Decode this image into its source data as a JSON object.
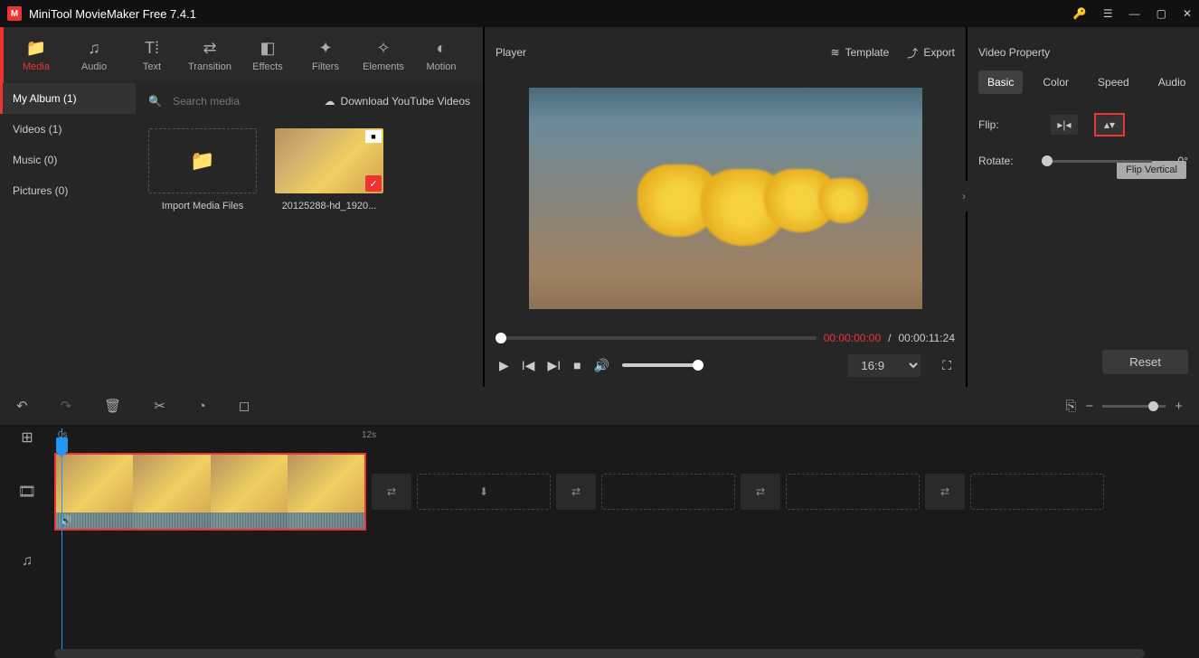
{
  "app": {
    "title": "MiniTool MovieMaker Free 7.4.1"
  },
  "toolbar": {
    "media": "Media",
    "audio": "Audio",
    "text": "Text",
    "transition": "Transition",
    "effects": "Effects",
    "filters": "Filters",
    "elements": "Elements",
    "motion": "Motion"
  },
  "album": {
    "my_album": "My Album (1)",
    "videos": "Videos (1)",
    "music": "Music (0)",
    "pictures": "Pictures (0)"
  },
  "media": {
    "search_placeholder": "Search media",
    "download_label": "Download YouTube Videos",
    "import_label": "Import Media Files",
    "clip_name": "20125288-hd_1920..."
  },
  "player": {
    "title": "Player",
    "template": "Template",
    "export": "Export",
    "time_current": "00:00:00:00",
    "time_total": "00:00:11:24",
    "ratio": "16:9"
  },
  "props": {
    "title": "Video Property",
    "tab_basic": "Basic",
    "tab_color": "Color",
    "tab_speed": "Speed",
    "tab_audio": "Audio",
    "flip_label": "Flip:",
    "rotate_label": "Rotate:",
    "rotate_value": "0°",
    "tooltip": "Flip Vertical",
    "reset": "Reset"
  },
  "timeline": {
    "t0": "0s",
    "t12": "12s"
  }
}
